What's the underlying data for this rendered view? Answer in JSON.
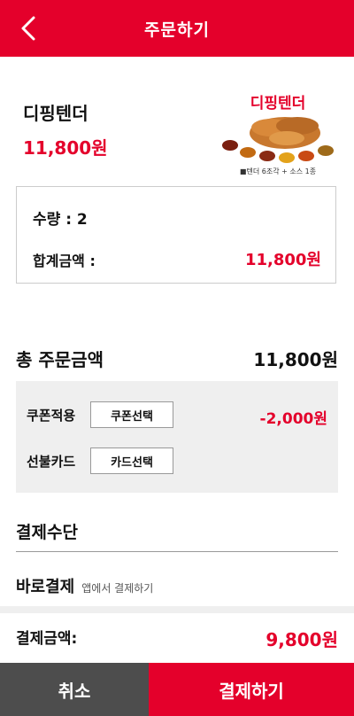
{
  "header": {
    "title": "주문하기",
    "back_icon": "chevron-left-icon"
  },
  "product": {
    "name": "디핑텐더",
    "price": "11,800원",
    "image_title": "디핑텐더",
    "image_caption": "■텐더 6조각 + 소스 1종"
  },
  "quantity": {
    "qty_text": "수량 : 2",
    "sum_label": "합계금액 :",
    "sum_value": "11,800원"
  },
  "total": {
    "label": "총 주문금액",
    "value": "11,800원"
  },
  "discounts": {
    "coupon_label": "쿠폰적용",
    "coupon_button": "쿠폰선택",
    "coupon_value": "-2,000원",
    "card_label": "선불카드",
    "card_button": "카드선택"
  },
  "payment": {
    "title": "결제수단",
    "method": "바로결제",
    "method_sub": "앱에서 결제하기"
  },
  "final": {
    "label": "결제금액:",
    "value": "9,800원"
  },
  "actions": {
    "cancel": "취소",
    "pay": "결제하기"
  },
  "colors": {
    "brand": "#e4002b",
    "dark": "#4d4d4d",
    "panel": "#efefef"
  }
}
